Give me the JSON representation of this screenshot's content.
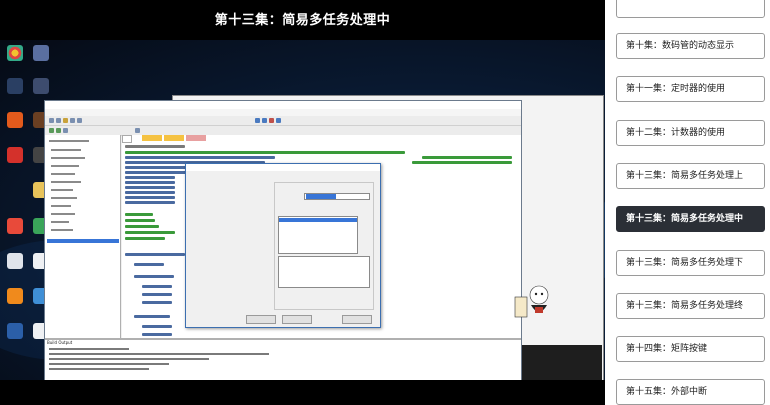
{
  "video": {
    "title": "第十三集：简易多任务处理中"
  },
  "playlist": {
    "episodes": [
      {
        "label": ""
      },
      {
        "label": "第十集：数码管的动态显示"
      },
      {
        "label": "第十一集：定时器的使用"
      },
      {
        "label": "第十二集：计数器的使用"
      },
      {
        "label": "第十三集：简易多任务处理上"
      },
      {
        "label": "第十三集：简易多任务处理中"
      },
      {
        "label": "第十三集：简易多任务处理下"
      },
      {
        "label": "第十三集：简易多任务处理终"
      },
      {
        "label": "第十四集：矩阵按键"
      },
      {
        "label": "第十五集：外部中断"
      }
    ],
    "active_index": 5,
    "active_bg": "#2b2f36"
  },
  "screen": {
    "output_title": "Build Output"
  },
  "colors": {
    "selection": "#3875d7",
    "desktop_bg": "#0a1c36"
  }
}
